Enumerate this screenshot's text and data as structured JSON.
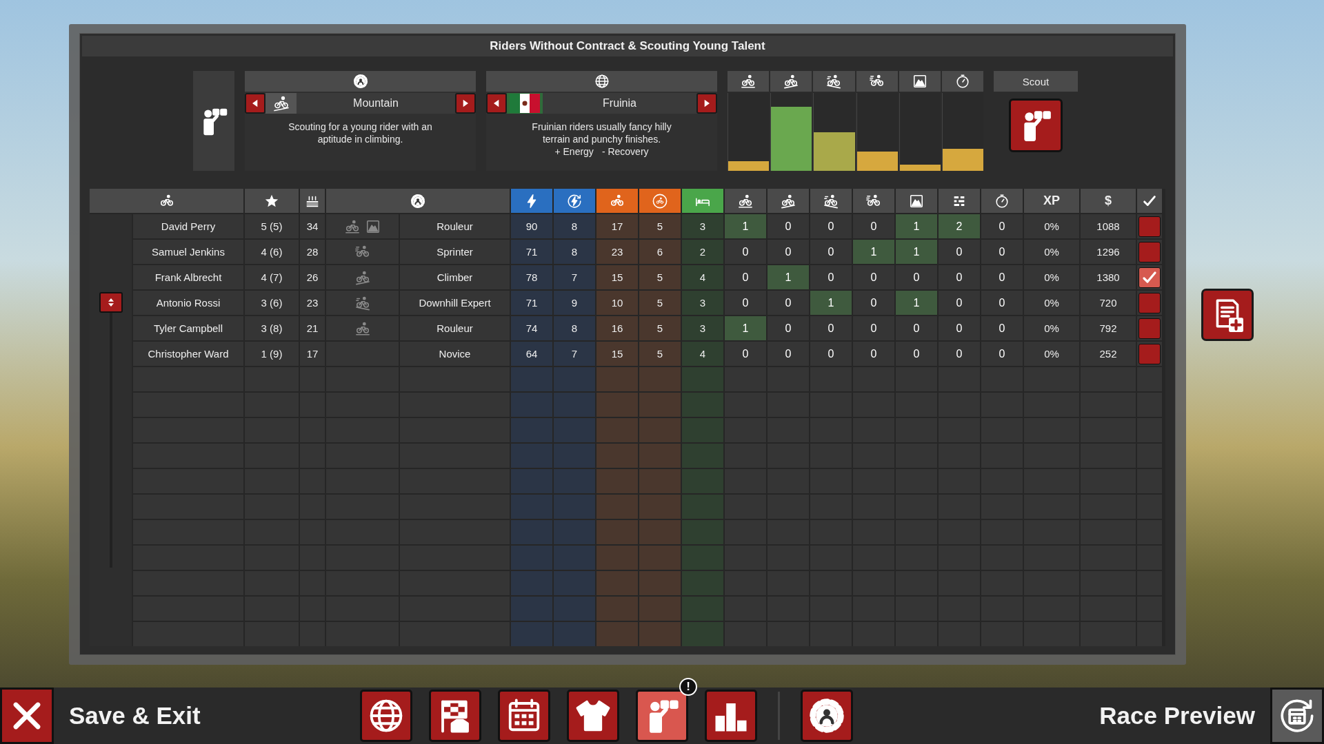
{
  "window": {
    "title": "Riders Without Contract & Scouting Young Talent"
  },
  "scouting": {
    "specialty": {
      "label": "Mountain",
      "description": "Scouting for a young rider with an aptitude in climbing."
    },
    "nationality": {
      "label": "Fruinia",
      "description": "Fruinian riders usually fancy hilly terrain and punchy finishes.",
      "bonuses": [
        "+ Energy",
        "- Recovery"
      ]
    },
    "terrain": [
      {
        "kind": "flat",
        "level": 0.12,
        "color": "#d6a83e"
      },
      {
        "kind": "climb",
        "level": 0.82,
        "color": "#6aa84f"
      },
      {
        "kind": "downhill",
        "level": 0.5,
        "color": "#a9a94a"
      },
      {
        "kind": "sprint",
        "level": 0.25,
        "color": "#d6a83e"
      },
      {
        "kind": "hill",
        "level": 0.08,
        "color": "#d6a83e"
      },
      {
        "kind": "time-trial",
        "level": 0.28,
        "color": "#d6a83e"
      }
    ],
    "scout_button": {
      "label": "Scout"
    }
  },
  "table": {
    "columns": [
      {
        "kind": "rider"
      },
      {
        "kind": "star"
      },
      {
        "kind": "age"
      },
      {
        "kind": "specialty"
      },
      {
        "kind": "energy"
      },
      {
        "kind": "recovery"
      },
      {
        "kind": "stamina"
      },
      {
        "kind": "stamina-recovery"
      },
      {
        "kind": "rest"
      },
      {
        "kind": "flat"
      },
      {
        "kind": "climb"
      },
      {
        "kind": "downhill"
      },
      {
        "kind": "sprint"
      },
      {
        "kind": "hill"
      },
      {
        "kind": "cobbles"
      },
      {
        "kind": "time-trial"
      },
      {
        "kind": "text",
        "label": "XP"
      },
      {
        "kind": "text",
        "label": "$"
      },
      {
        "kind": "check"
      }
    ],
    "rows": [
      {
        "name": "David Perry",
        "rating": "5 (5)",
        "age": "34",
        "traits": [
          {
            "kind": "flat"
          },
          {
            "kind": "hill"
          }
        ],
        "specialty": "Rouleur",
        "core": [
          "90",
          "8",
          "17",
          "5",
          "3"
        ],
        "skills": [
          {
            "value": "1",
            "highlighted": true
          },
          {
            "value": "0",
            "highlighted": false
          },
          {
            "value": "0",
            "highlighted": false
          },
          {
            "value": "0",
            "highlighted": false
          },
          {
            "value": "1",
            "highlighted": true
          },
          {
            "value": "2",
            "highlighted": true
          },
          {
            "value": "0",
            "highlighted": false
          }
        ],
        "xp": "0%",
        "salary": "1088",
        "checked": false
      },
      {
        "name": "Samuel Jenkins",
        "rating": "4 (6)",
        "age": "28",
        "traits": [
          {
            "kind": "sprint"
          }
        ],
        "specialty": "Sprinter",
        "core": [
          "71",
          "8",
          "23",
          "6",
          "2"
        ],
        "skills": [
          {
            "value": "0",
            "highlighted": false
          },
          {
            "value": "0",
            "highlighted": false
          },
          {
            "value": "0",
            "highlighted": false
          },
          {
            "value": "1",
            "highlighted": true
          },
          {
            "value": "1",
            "highlighted": true
          },
          {
            "value": "0",
            "highlighted": false
          },
          {
            "value": "0",
            "highlighted": false
          }
        ],
        "xp": "0%",
        "salary": "1296",
        "checked": false
      },
      {
        "name": "Frank Albrecht",
        "rating": "4 (7)",
        "age": "26",
        "traits": [
          {
            "kind": "climb"
          }
        ],
        "specialty": "Climber",
        "core": [
          "78",
          "7",
          "15",
          "5",
          "4"
        ],
        "skills": [
          {
            "value": "0",
            "highlighted": false
          },
          {
            "value": "1",
            "highlighted": true
          },
          {
            "value": "0",
            "highlighted": false
          },
          {
            "value": "0",
            "highlighted": false
          },
          {
            "value": "0",
            "highlighted": false
          },
          {
            "value": "0",
            "highlighted": false
          },
          {
            "value": "0",
            "highlighted": false
          }
        ],
        "xp": "0%",
        "salary": "1380",
        "checked": true
      },
      {
        "name": "Antonio Rossi",
        "rating": "3 (6)",
        "age": "23",
        "traits": [
          {
            "kind": "downhill"
          }
        ],
        "specialty": "Downhill Expert",
        "core": [
          "71",
          "9",
          "10",
          "5",
          "3"
        ],
        "skills": [
          {
            "value": "0",
            "highlighted": false
          },
          {
            "value": "0",
            "highlighted": false
          },
          {
            "value": "1",
            "highlighted": true
          },
          {
            "value": "0",
            "highlighted": false
          },
          {
            "value": "1",
            "highlighted": true
          },
          {
            "value": "0",
            "highlighted": false
          },
          {
            "value": "0",
            "highlighted": false
          }
        ],
        "xp": "0%",
        "salary": "720",
        "checked": false
      },
      {
        "name": "Tyler Campbell",
        "rating": "3 (8)",
        "age": "21",
        "traits": [
          {
            "kind": "flat"
          }
        ],
        "specialty": "Rouleur",
        "core": [
          "74",
          "8",
          "16",
          "5",
          "3"
        ],
        "skills": [
          {
            "value": "1",
            "highlighted": true
          },
          {
            "value": "0",
            "highlighted": false
          },
          {
            "value": "0",
            "highlighted": false
          },
          {
            "value": "0",
            "highlighted": false
          },
          {
            "value": "0",
            "highlighted": false
          },
          {
            "value": "0",
            "highlighted": false
          },
          {
            "value": "0",
            "highlighted": false
          }
        ],
        "xp": "0%",
        "salary": "792",
        "checked": false
      },
      {
        "name": "Christopher Ward",
        "rating": "1 (9)",
        "age": "17",
        "traits": [],
        "specialty": "Novice",
        "core": [
          "64",
          "7",
          "15",
          "5",
          "4"
        ],
        "skills": [
          {
            "value": "0",
            "highlighted": false
          },
          {
            "value": "0",
            "highlighted": false
          },
          {
            "value": "0",
            "highlighted": false
          },
          {
            "value": "0",
            "highlighted": false
          },
          {
            "value": "0",
            "highlighted": false
          },
          {
            "value": "0",
            "highlighted": false
          },
          {
            "value": "0",
            "highlighted": false
          }
        ],
        "xp": "0%",
        "salary": "252",
        "checked": false
      }
    ]
  },
  "bottom_bar": {
    "exit_label": "Save & Exit",
    "nav": [
      {
        "kind": "globe",
        "selected": false
      },
      {
        "kind": "race-flag",
        "selected": false
      },
      {
        "kind": "calendar",
        "selected": false
      },
      {
        "kind": "jerseys",
        "selected": false
      },
      {
        "kind": "scouting",
        "selected": true,
        "badge": "!"
      },
      {
        "kind": "rankings",
        "selected": false
      },
      {
        "kind": "settings",
        "selected": false
      }
    ],
    "next_label": "Race Preview"
  }
}
